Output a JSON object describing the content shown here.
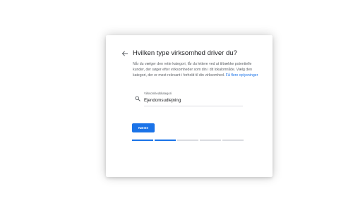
{
  "dialog": {
    "title": "Hvilken type virksomhed driver du?",
    "description": "Når du vælger den rette kategori, får du lettere ved at tiltrække potentielle kunder, der søger efter virksomheder som din i dit lokalområde. Vælg den kategori, der er mest relevant i forhold til din virksomhed.",
    "learn_more_link": "Få flere oplysninger",
    "category_field": {
      "label": "Virksomhedskategori",
      "value": "Ejendomsudlejning"
    },
    "next_button": "Næste",
    "progress": {
      "total_steps": 5,
      "completed_steps": 2
    }
  },
  "colors": {
    "accent": "#1a73e8",
    "title_text": "#202124",
    "secondary_text": "#5f6368",
    "divider": "#dadce0"
  },
  "icons": {
    "back": "arrow-back-icon",
    "search": "search-icon"
  }
}
